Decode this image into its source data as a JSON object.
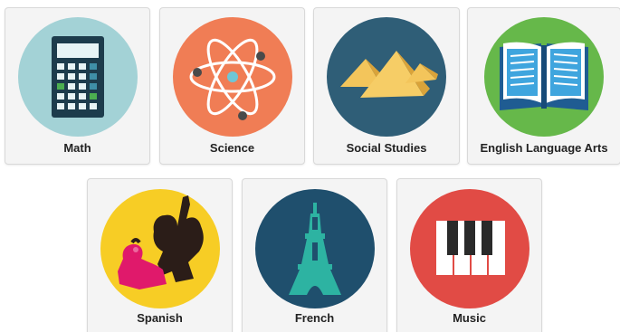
{
  "subjects": [
    {
      "id": "math",
      "label": "Math",
      "icon": "calculator-icon",
      "color": "#9fd0d3"
    },
    {
      "id": "science",
      "label": "Science",
      "icon": "atom-icon",
      "color": "#f07b53"
    },
    {
      "id": "social",
      "label": "Social Studies",
      "icon": "pyramids-icon",
      "color": "#2f5f78"
    },
    {
      "id": "ela",
      "label": "English Language Arts",
      "icon": "open-book-icon",
      "color": "#67b84b"
    },
    {
      "id": "spanish",
      "label": "Spanish",
      "icon": "flamenco-dancers-icon",
      "color": "#f6cc24"
    },
    {
      "id": "french",
      "label": "French",
      "icon": "eiffel-tower-icon",
      "color": "#1f4e6b"
    },
    {
      "id": "music",
      "label": "Music",
      "icon": "piano-keys-icon",
      "color": "#e04b45"
    }
  ]
}
